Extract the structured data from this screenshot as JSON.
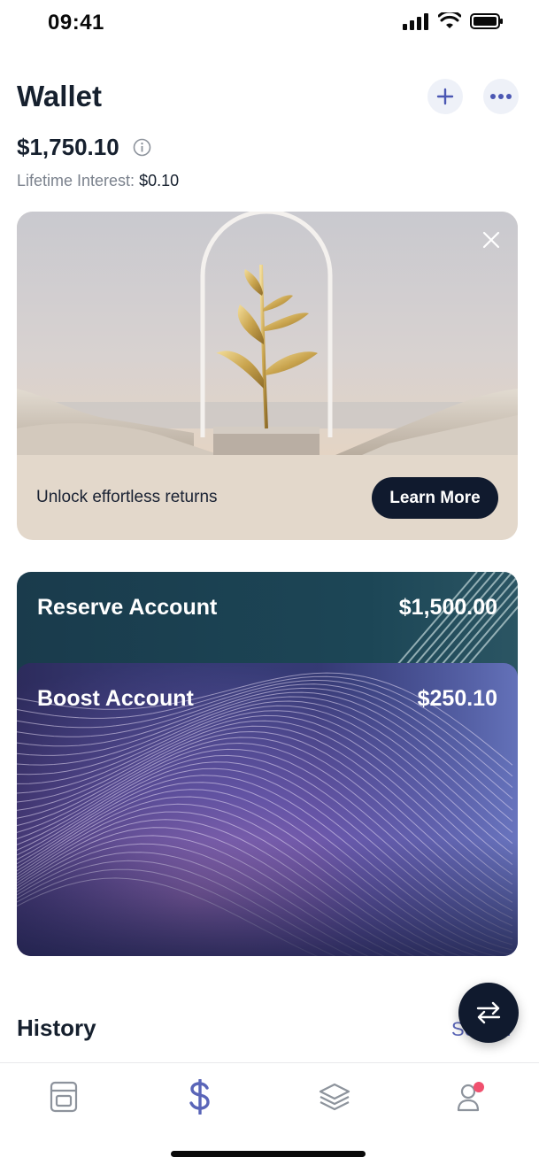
{
  "status_bar": {
    "time": "09:41"
  },
  "header": {
    "title": "Wallet",
    "add_icon": "plus-icon",
    "more_icon": "ellipsis-icon"
  },
  "summary": {
    "balance": "$1,750.10",
    "interest_label": "Lifetime Interest:",
    "interest_value": "$0.10"
  },
  "promo": {
    "text": "Unlock effortless returns",
    "button_label": "Learn More"
  },
  "accounts": [
    {
      "name": "Reserve Account",
      "amount": "$1,500.00"
    },
    {
      "name": "Boost Account",
      "amount": "$250.10"
    }
  ],
  "history": {
    "title": "History",
    "see_all": "See all"
  },
  "tab_bar": {
    "tabs": [
      {
        "icon": "card-icon",
        "active": false
      },
      {
        "icon": "dollar-icon",
        "active": true
      },
      {
        "icon": "layers-icon",
        "active": false
      },
      {
        "icon": "profile-icon",
        "active": false,
        "badge": true
      }
    ]
  },
  "colors": {
    "accent": "#5a65b8",
    "dark": "#101a2e",
    "badge": "#f0506e"
  }
}
